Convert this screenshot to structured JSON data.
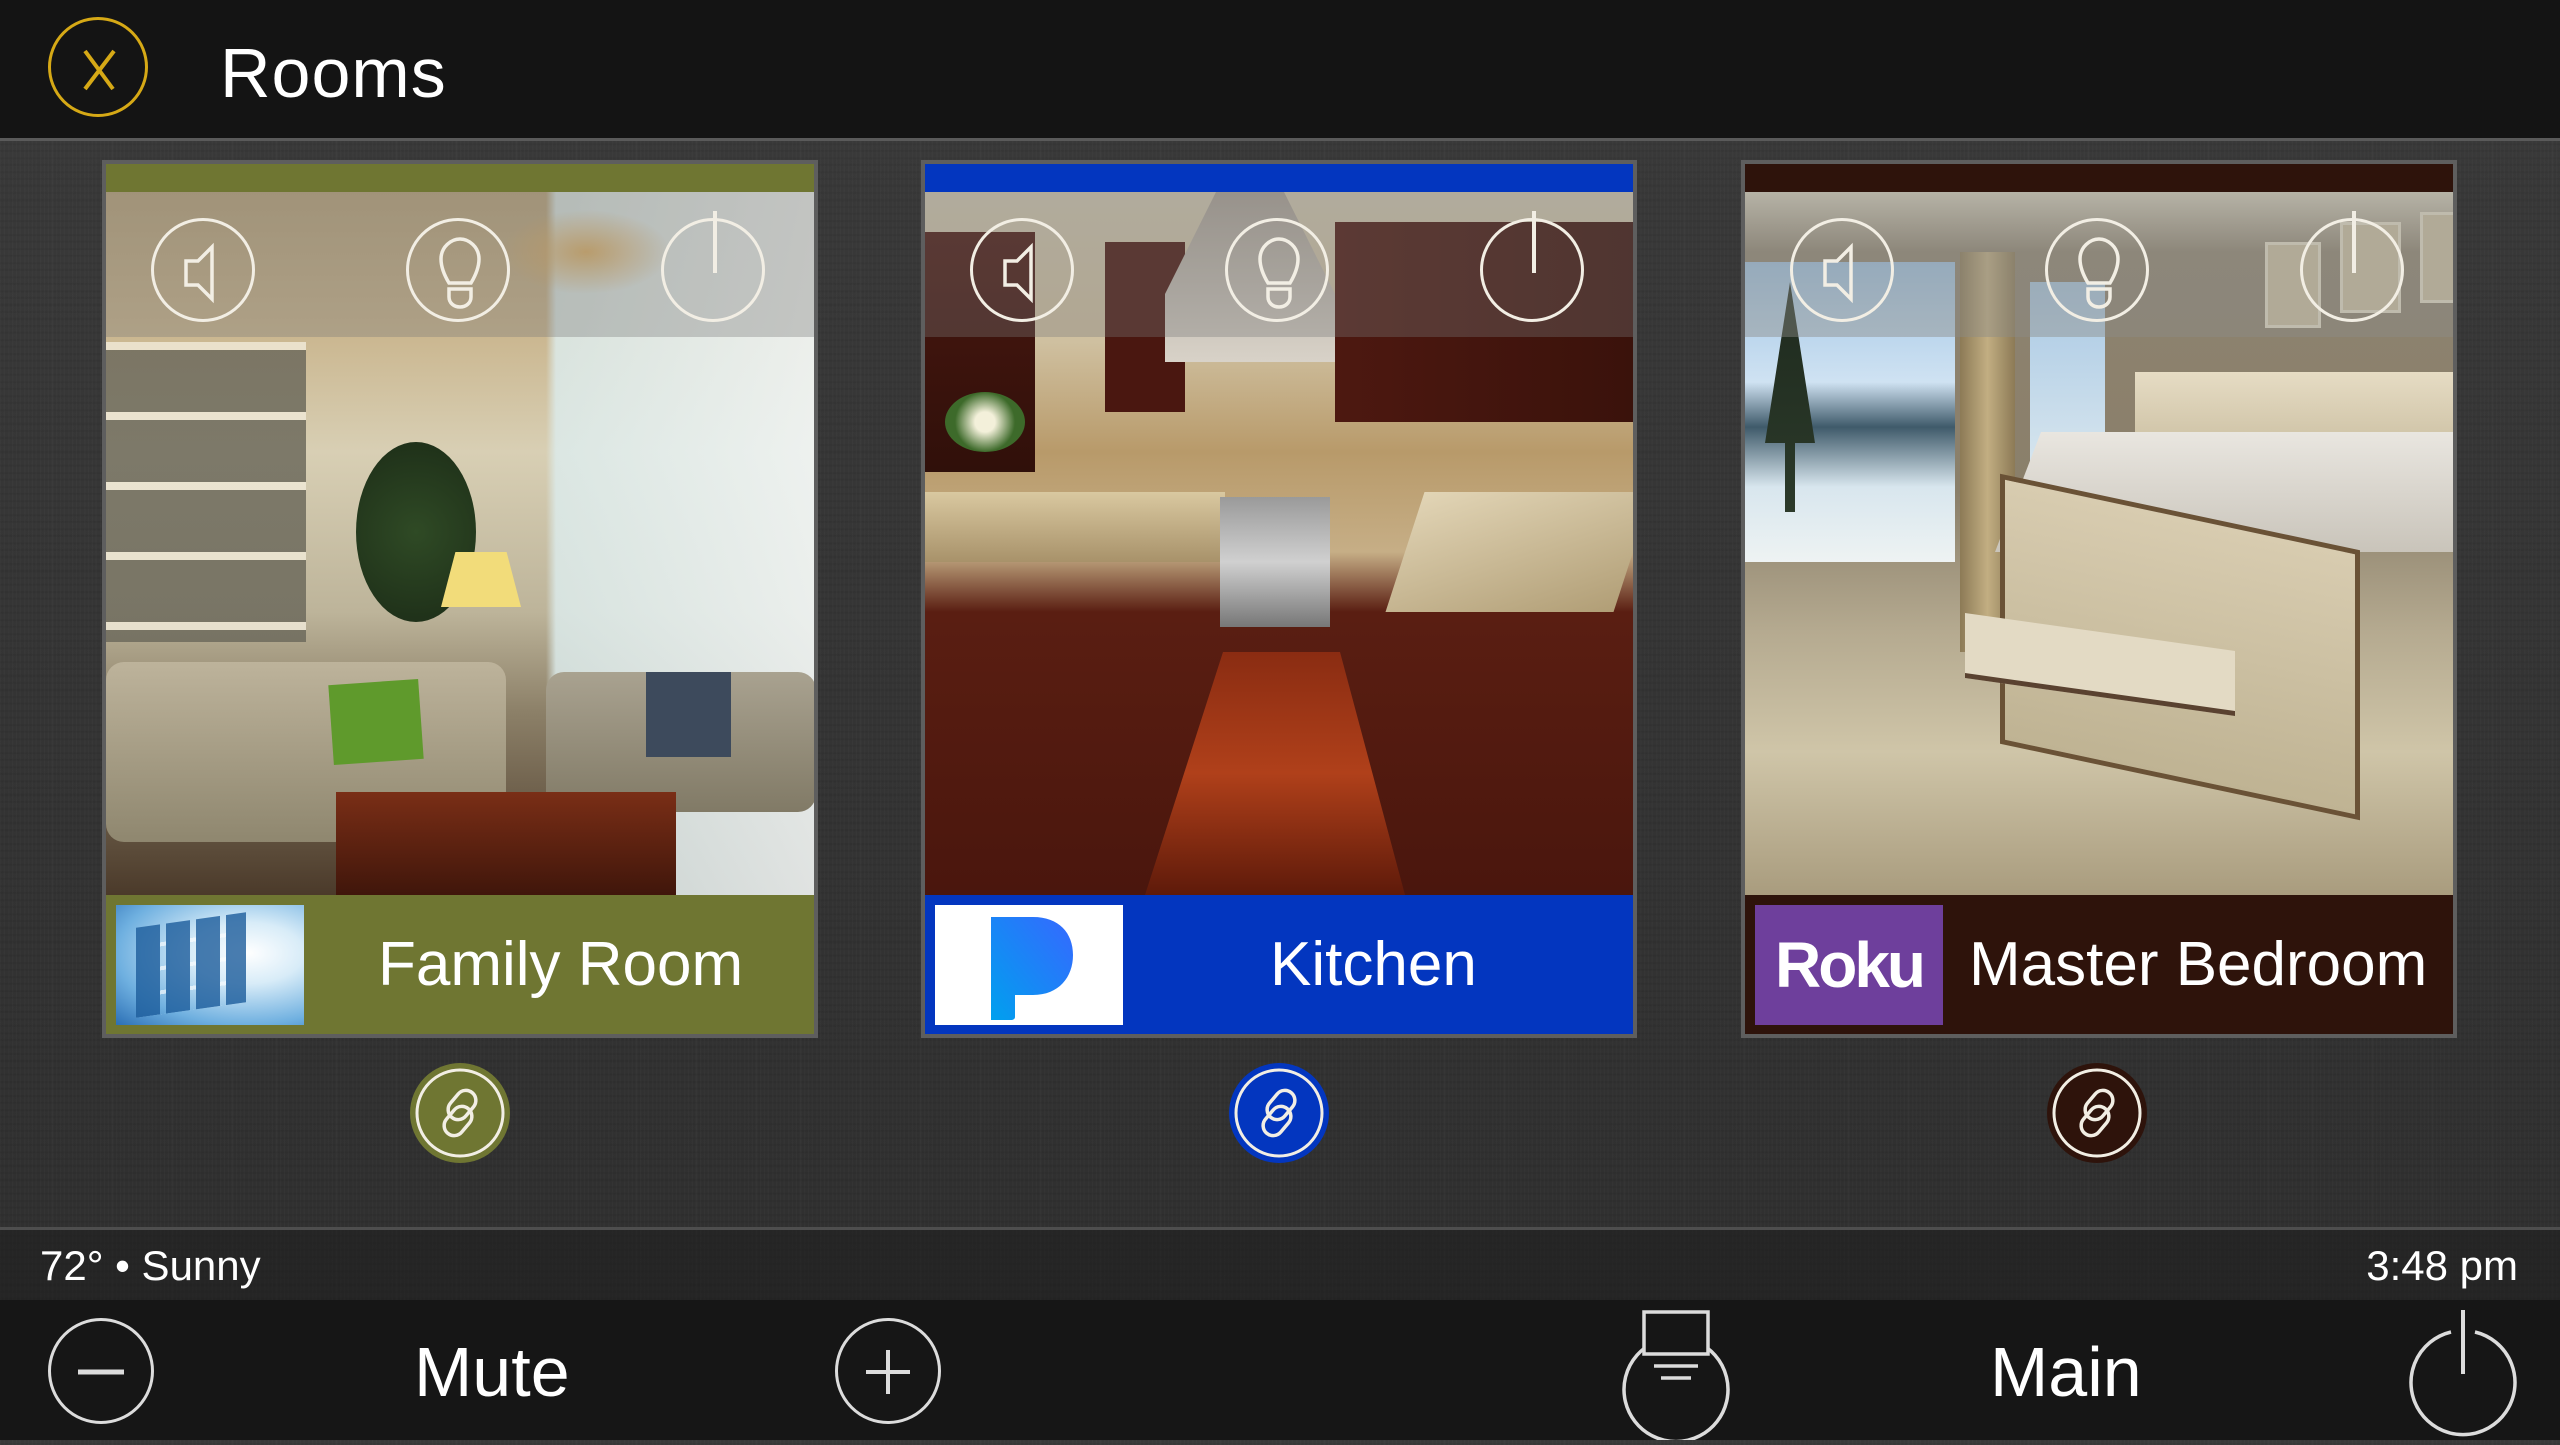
{
  "header": {
    "title": "Rooms",
    "close_icon": "close-x-icon",
    "accent_color": "#d6a916"
  },
  "rooms": [
    {
      "name": "Family Room",
      "theme_color": "#6f7632",
      "source": "video-wall-thumbnail",
      "source_label": "",
      "scene": "living-room-photo",
      "controls": [
        "volume-icon",
        "lightbulb-icon",
        "power-icon"
      ],
      "link_icon": "link-chain-icon"
    },
    {
      "name": "Kitchen",
      "theme_color": "#0336bf",
      "source": "pandora-logo",
      "source_label": "P",
      "scene": "kitchen-photo",
      "controls": [
        "volume-icon",
        "lightbulb-icon",
        "power-icon"
      ],
      "link_icon": "link-chain-icon"
    },
    {
      "name": "Master Bedroom",
      "theme_color": "#2e130b",
      "source": "roku-logo",
      "source_label": "Roku",
      "scene": "bedroom-photo",
      "controls": [
        "volume-icon",
        "lightbulb-icon",
        "power-icon"
      ],
      "link_icon": "link-chain-icon"
    }
  ],
  "status": {
    "weather": "72° • Sunny",
    "time": "3:48 pm"
  },
  "controls": {
    "volume_down_icon": "minus-icon",
    "mute_label": "Mute",
    "volume_up_icon": "plus-icon",
    "source_icon": "display-source-icon",
    "zone_label": "Main",
    "power_icon": "power-icon"
  }
}
